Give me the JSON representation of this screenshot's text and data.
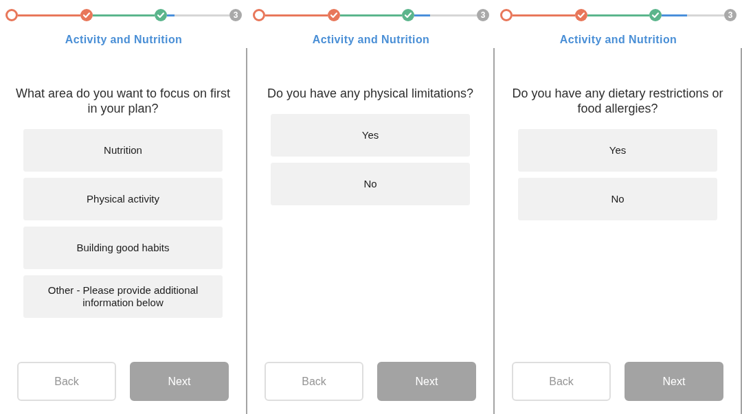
{
  "screens": [
    {
      "progress": {
        "steps": [
          {
            "kind": "start",
            "color": "#e8775a"
          },
          {
            "kind": "done",
            "color": "#e8775a"
          },
          {
            "kind": "done",
            "color": "#5bb58c"
          },
          {
            "kind": "pending",
            "label": "3"
          }
        ],
        "level": 0.12
      },
      "title": "Activity and Nutrition",
      "question": "What area do you want to focus on first in your plan?",
      "options": [
        {
          "label": "Nutrition",
          "selected": false
        },
        {
          "label": "Physical activity",
          "selected": false
        },
        {
          "label": "Building good habits",
          "selected": false
        },
        {
          "label": "Other - Please provide additional information below",
          "selected": false
        }
      ],
      "buttons": [
        {
          "kind": "back",
          "label": "Back",
          "disabled": true
        },
        {
          "kind": "next",
          "label": "Next",
          "disabled": true
        }
      ]
    },
    {
      "progress": {
        "steps": [
          {
            "kind": "start",
            "color": "#e8775a"
          },
          {
            "kind": "done",
            "color": "#e8775a"
          },
          {
            "kind": "done",
            "color": "#5bb58c"
          },
          {
            "kind": "pending",
            "label": "3"
          }
        ],
        "level": 0.25
      },
      "title": "Activity and Nutrition",
      "question": "Do you have any physical limitations?",
      "options": [
        {
          "label": "Yes",
          "selected": false
        },
        {
          "label": "No",
          "selected": false
        }
      ],
      "buttons": [
        {
          "kind": "back",
          "label": "Back",
          "disabled": true
        },
        {
          "kind": "next",
          "label": "Next",
          "disabled": true
        }
      ]
    },
    {
      "progress": {
        "steps": [
          {
            "kind": "start",
            "color": "#e8775a"
          },
          {
            "kind": "done",
            "color": "#e8775a"
          },
          {
            "kind": "done",
            "color": "#5bb58c"
          },
          {
            "kind": "pending",
            "label": "3"
          }
        ],
        "level": 0.4
      },
      "title": "Activity and Nutrition",
      "question": "Do you have any dietary restrictions or food allergies?",
      "options": [
        {
          "label": "Yes",
          "selected": false
        },
        {
          "label": "No",
          "selected": false
        }
      ],
      "buttons": [
        {
          "kind": "back",
          "label": "Back",
          "disabled": true
        },
        {
          "kind": "next",
          "label": "Next",
          "disabled": true
        }
      ]
    }
  ]
}
